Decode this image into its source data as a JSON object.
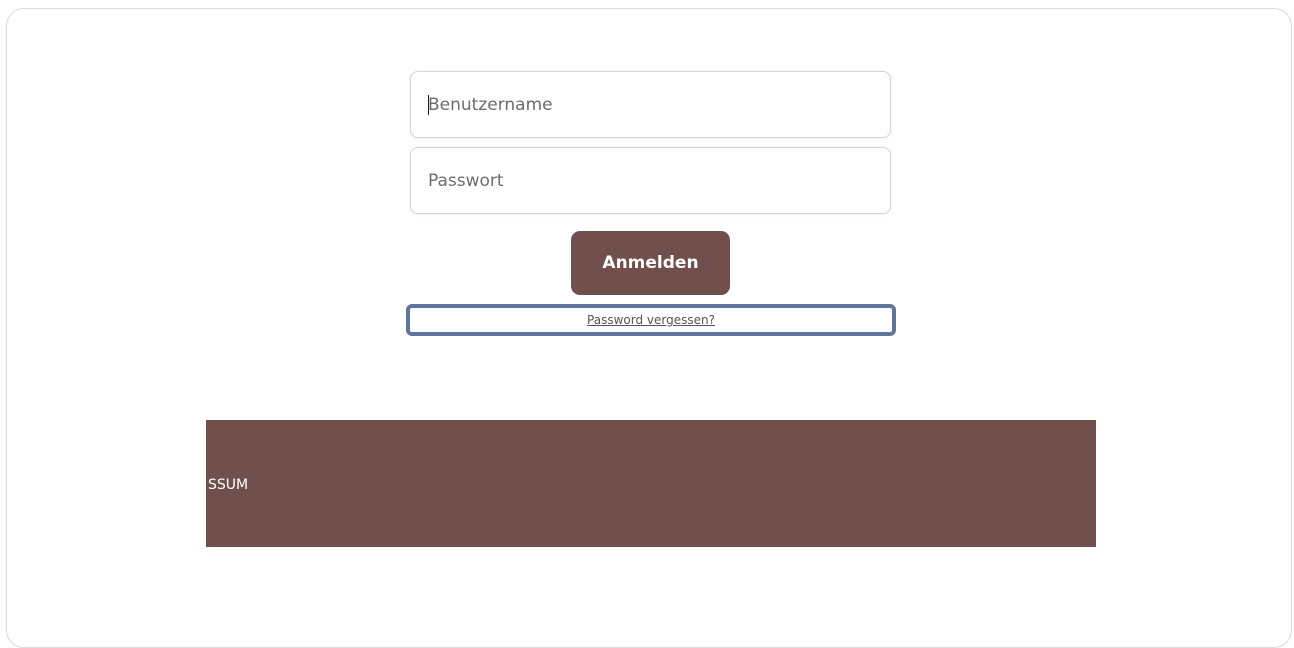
{
  "login": {
    "username": {
      "placeholder": "Benutzername",
      "value": ""
    },
    "password": {
      "placeholder": "Passwort",
      "value": ""
    },
    "submit_label": "Anmelden",
    "forgot_label": "Password vergessen?"
  },
  "footer": {
    "text": "SSUM"
  },
  "colors": {
    "accent": "#714f4c",
    "highlight": "#60759e"
  }
}
